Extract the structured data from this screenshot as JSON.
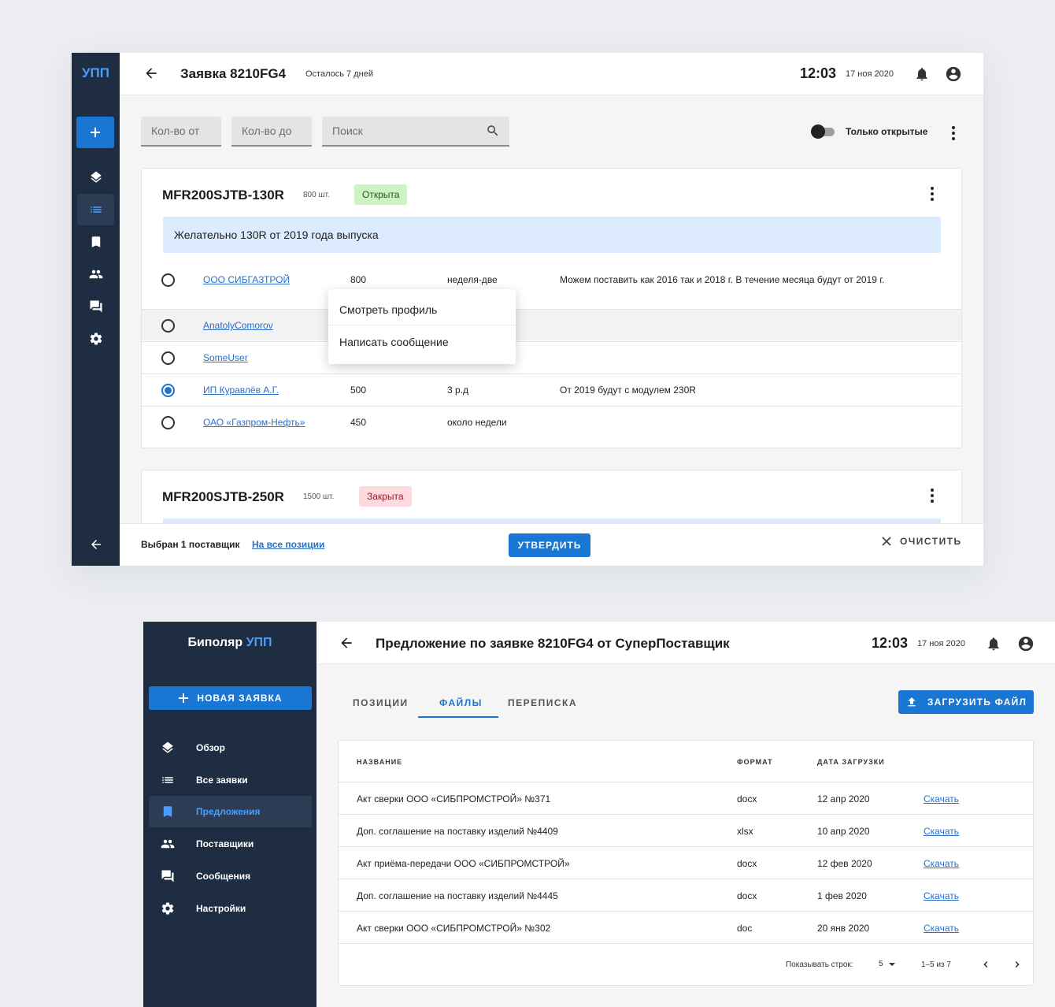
{
  "window1": {
    "logo": "УПП",
    "header": {
      "title": "Заявка 8210FG4",
      "subtitle": "Осталось 7 дней",
      "time": "12:03",
      "date": "17 ноя 2020"
    },
    "filters": {
      "qty_from_placeholder": "Кол-во от",
      "qty_to_placeholder": "Кол-во до",
      "search_placeholder": "Поиск",
      "toggle_label": "Только открытые",
      "toggle_on": false
    },
    "card1": {
      "title": "MFR200SJTB-130R",
      "qty": "800 шт.",
      "status": "Открыта",
      "note": "Желательно 130R от 2019 года выпуска",
      "suppliers": [
        {
          "name": "ООО СИБГАЗТРОЙ",
          "qty": "800",
          "term": "неделя-две",
          "comment": "Можем поставить как 2016 так и 2018 г. В течение месяца будут от 2019 г.",
          "selected": false
        },
        {
          "name": "AnatolyComorov",
          "qty": "",
          "term": "",
          "comment": "",
          "selected": false
        },
        {
          "name": "SomeUser",
          "qty": "",
          "term": "",
          "comment": "",
          "selected": false
        },
        {
          "name": "ИП Куравлёв А.Г.",
          "qty": "500",
          "term": "3 р.д",
          "comment": "От 2019 будут с модулем 230R",
          "selected": true
        },
        {
          "name": "ОАО «Газпром-Нефть»",
          "qty": "450",
          "term": "около недели",
          "comment": "",
          "selected": false
        }
      ]
    },
    "context_menu": {
      "items": [
        "Смотреть профиль",
        "Написать сообщение"
      ]
    },
    "card2": {
      "title": "MFR200SJTB-250R",
      "qty": "1500 шт.",
      "status": "Закрыта"
    },
    "footer": {
      "selected_text": "Выбран 1 поставщик",
      "all_positions_link": "На все позиции",
      "approve_label": "УТВЕРДИТЬ",
      "clear_label": "ОЧИСТИТЬ"
    }
  },
  "window2": {
    "brand_main": "Биполяр",
    "brand_accent": "УПП",
    "new_request_label": "НОВАЯ ЗАЯВКА",
    "nav": [
      {
        "label": "Обзор",
        "icon": "layers-icon",
        "active": false
      },
      {
        "label": "Все заявки",
        "icon": "list-icon",
        "active": false
      },
      {
        "label": "Предложения",
        "icon": "bookmark-icon",
        "active": true
      },
      {
        "label": "Поставщики",
        "icon": "people-icon",
        "active": false
      },
      {
        "label": "Сообщения",
        "icon": "chat-icon",
        "active": false
      },
      {
        "label": "Настройки",
        "icon": "gear-icon",
        "active": false
      }
    ],
    "header": {
      "title": "Предложение по заявке 8210FG4 от СуперПоставщик",
      "time": "12:03",
      "date": "17 ноя 2020"
    },
    "tabs": [
      {
        "label": "ПОЗИЦИИ",
        "active": false
      },
      {
        "label": "ФАЙЛЫ",
        "active": true
      },
      {
        "label": "ПЕРЕПИСКА",
        "active": false
      }
    ],
    "upload_label": "ЗАГРУЗИТЬ ФАЙЛ",
    "table": {
      "columns": [
        "НАЗВАНИЕ",
        "ФОРМАТ",
        "ДАТА ЗАГРУЗКИ"
      ],
      "rows": [
        {
          "name": "Акт сверки ООО «СИБПРОМСТРОЙ» №371",
          "format": "docx",
          "date": "12 апр 2020",
          "action": "Скачать"
        },
        {
          "name": "Доп. соглашение на поставку изделий №4409",
          "format": "xlsx",
          "date": "10 апр 2020",
          "action": "Скачать"
        },
        {
          "name": "Акт приёма-передачи ООО «СИБПРОМСТРОЙ»",
          "format": "docx",
          "date": "12 фев 2020",
          "action": "Скачать"
        },
        {
          "name": "Доп. соглашение на поставку изделий №4445",
          "format": "docx",
          "date": "1 фев 2020",
          "action": "Скачать"
        },
        {
          "name": "Акт сверки ООО «СИБПРОМСТРОЙ» №302",
          "format": "doc",
          "date": "20 янв 2020",
          "action": "Скачать"
        }
      ],
      "pagination": {
        "rows_label": "Показывать строк:",
        "rows_value": "5",
        "range": "1–5 из 7"
      }
    }
  },
  "colors": {
    "accent": "#1976d2",
    "sidebar": "#1f2d42",
    "open_chip": "#cdf3c4",
    "closed_chip": "#fcdadd"
  }
}
